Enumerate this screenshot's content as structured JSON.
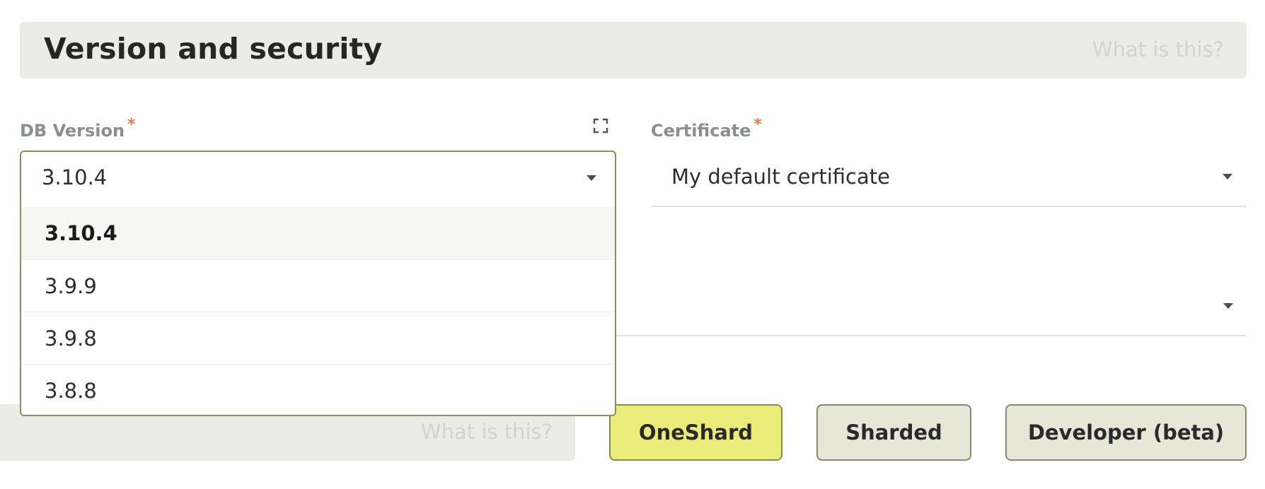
{
  "section": {
    "title": "Version and security",
    "help_label": "What is this?"
  },
  "db_version": {
    "label": "DB Version",
    "required_marker": "*",
    "value": "3.10.4",
    "options": [
      {
        "label": "3.10.4",
        "selected": true
      },
      {
        "label": "3.9.9",
        "selected": false
      },
      {
        "label": "3.9.8",
        "selected": false
      },
      {
        "label": "3.8.8",
        "selected": false
      }
    ]
  },
  "certificate": {
    "label": "Certificate",
    "required_marker": "*",
    "value": "My default certificate"
  },
  "second_select": {
    "value": ""
  },
  "deployment": {
    "help_label": "What is this?",
    "modes": [
      {
        "label": "OneShard",
        "active": true
      },
      {
        "label": "Sharded",
        "active": false
      },
      {
        "label": "Developer (beta)",
        "active": false
      }
    ]
  },
  "colors": {
    "accent_active": "#e9ec78",
    "button_bg": "#e7e7d8",
    "header_bg": "#ebebe7",
    "required": "#ef7d4a"
  },
  "icons": [
    "fullscreen-icon",
    "caret-down-icon"
  ]
}
